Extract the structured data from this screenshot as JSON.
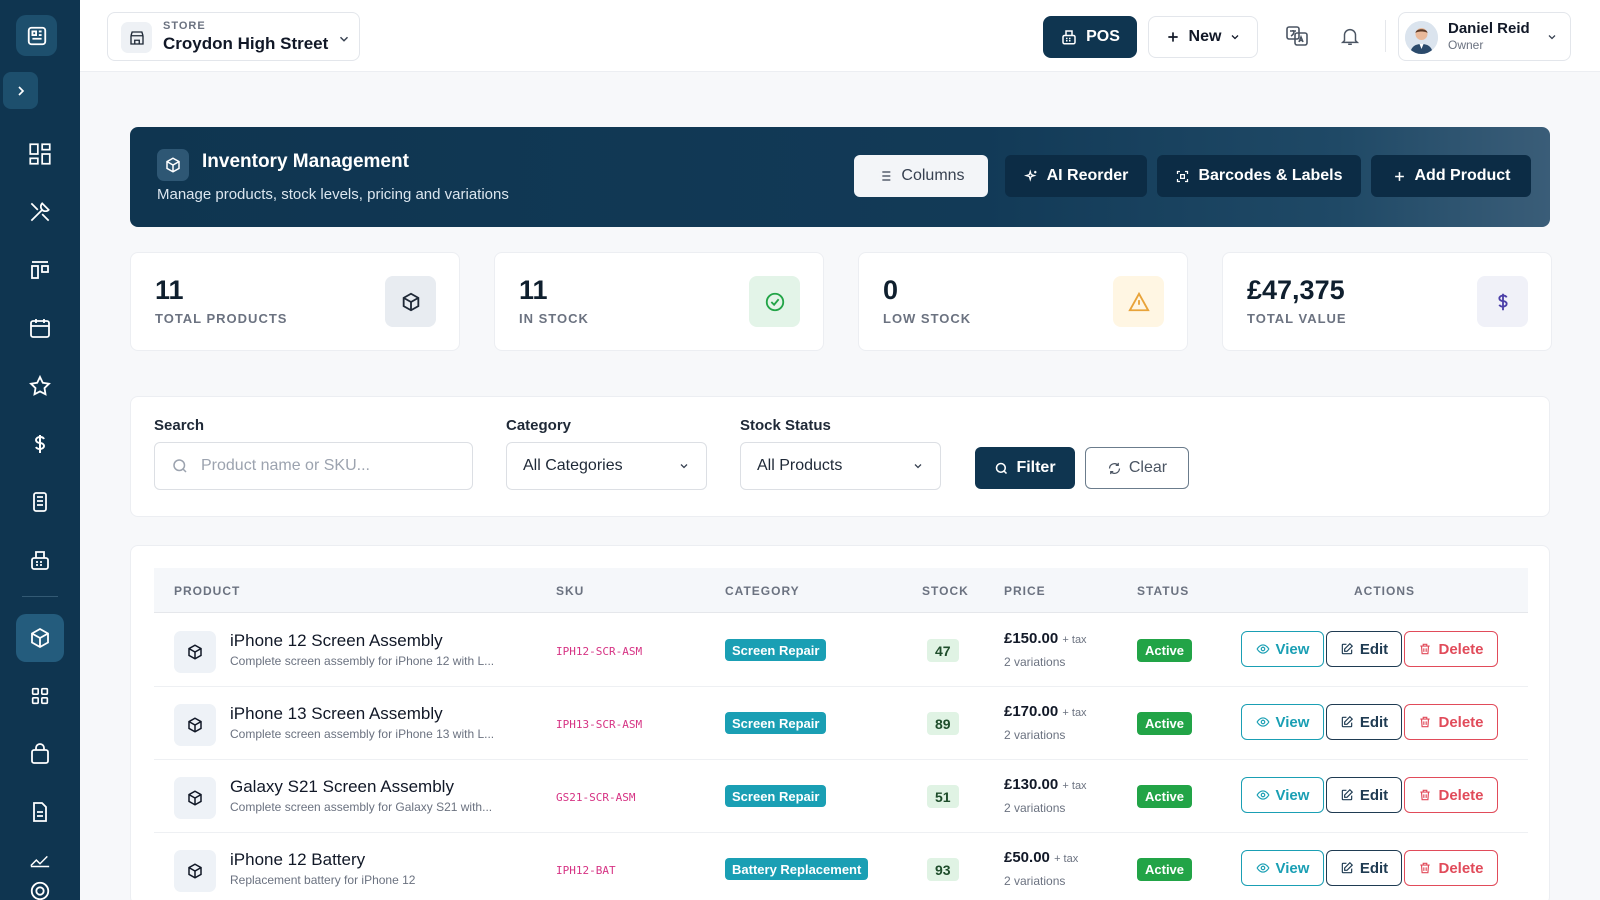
{
  "colors": {
    "navy": "#0f3550",
    "teal": "#1a9fb4",
    "green": "#22a447",
    "red": "#e14b5a",
    "sku": "#d63384"
  },
  "sidebar": {
    "logo_icon": "pos-terminal-icon",
    "toggle_icon": "chevron-right-icon",
    "items": [
      {
        "name": "dashboard",
        "icon": "dashboard-icon"
      },
      {
        "name": "repairs",
        "icon": "tools-icon"
      },
      {
        "name": "job-board",
        "icon": "kanban-icon"
      },
      {
        "name": "calendar",
        "icon": "calendar-icon"
      },
      {
        "name": "reviews",
        "icon": "star-icon"
      },
      {
        "name": "finance",
        "icon": "dollar-icon"
      },
      {
        "name": "devices",
        "icon": "phone-stack-icon"
      },
      {
        "name": "pos",
        "icon": "register-icon"
      },
      {
        "name": "inventory",
        "icon": "box-icon",
        "active": true
      },
      {
        "name": "apps",
        "icon": "grid-icon"
      },
      {
        "name": "sales",
        "icon": "bag-icon"
      },
      {
        "name": "documents",
        "icon": "document-icon"
      },
      {
        "name": "reports",
        "icon": "chart-icon"
      },
      {
        "name": "support",
        "icon": "lifebuoy-icon"
      }
    ]
  },
  "topbar": {
    "store_label": "STORE",
    "store_name": "Croydon High Street",
    "pos_label": "POS",
    "new_label": "New",
    "user_name": "Daniel Reid",
    "user_role": "Owner"
  },
  "hero": {
    "title": "Inventory Management",
    "subtitle": "Manage products, stock levels, pricing and variations",
    "buttons": {
      "columns": "Columns",
      "ai_reorder": "AI Reorder",
      "barcodes": "Barcodes & Labels",
      "add_product": "Add Product"
    }
  },
  "stats": [
    {
      "value": "11",
      "label": "TOTAL PRODUCTS",
      "icon": "box-icon",
      "bg": "#e8ecf1",
      "fg": "#1f2937"
    },
    {
      "value": "11",
      "label": "IN STOCK",
      "icon": "check-circle-icon",
      "bg": "#e3f4e8",
      "fg": "#22a447"
    },
    {
      "value": "0",
      "label": "LOW STOCK",
      "icon": "warning-icon",
      "bg": "#fff6e3",
      "fg": "#e8a33a"
    },
    {
      "value": "£47,375",
      "label": "TOTAL VALUE",
      "icon": "dollar-icon",
      "bg": "#f0f1f8",
      "fg": "#4b3fa8"
    }
  ],
  "filters": {
    "search_label": "Search",
    "search_placeholder": "Product name or SKU...",
    "category_label": "Category",
    "category_value": "All Categories",
    "status_label": "Stock Status",
    "status_value": "All Products",
    "filter_button": "Filter",
    "clear_button": "Clear"
  },
  "table": {
    "headers": [
      "PRODUCT",
      "SKU",
      "CATEGORY",
      "STOCK",
      "PRICE",
      "STATUS",
      "ACTIONS"
    ],
    "tax_suffix": "+ tax",
    "actions": {
      "view": "View",
      "edit": "Edit",
      "delete": "Delete"
    },
    "rows": [
      {
        "name": "iPhone 12 Screen Assembly",
        "desc": "Complete screen assembly for iPhone 12 with L...",
        "sku": "IPH12-SCR-ASM",
        "category": "Screen Repair",
        "stock": "47",
        "price": "£150.00",
        "variations": "2 variations",
        "status": "Active"
      },
      {
        "name": "iPhone 13 Screen Assembly",
        "desc": "Complete screen assembly for iPhone 13 with L...",
        "sku": "IPH13-SCR-ASM",
        "category": "Screen Repair",
        "stock": "89",
        "price": "£170.00",
        "variations": "2 variations",
        "status": "Active"
      },
      {
        "name": "Galaxy S21 Screen Assembly",
        "desc": "Complete screen assembly for Galaxy S21 with...",
        "sku": "GS21-SCR-ASM",
        "category": "Screen Repair",
        "stock": "51",
        "price": "£130.00",
        "variations": "2 variations",
        "status": "Active"
      },
      {
        "name": "iPhone 12 Battery",
        "desc": "Replacement battery for iPhone 12",
        "sku": "IPH12-BAT",
        "category": "Battery Replacement",
        "stock": "93",
        "price": "£50.00",
        "variations": "2 variations",
        "status": "Active"
      }
    ]
  }
}
